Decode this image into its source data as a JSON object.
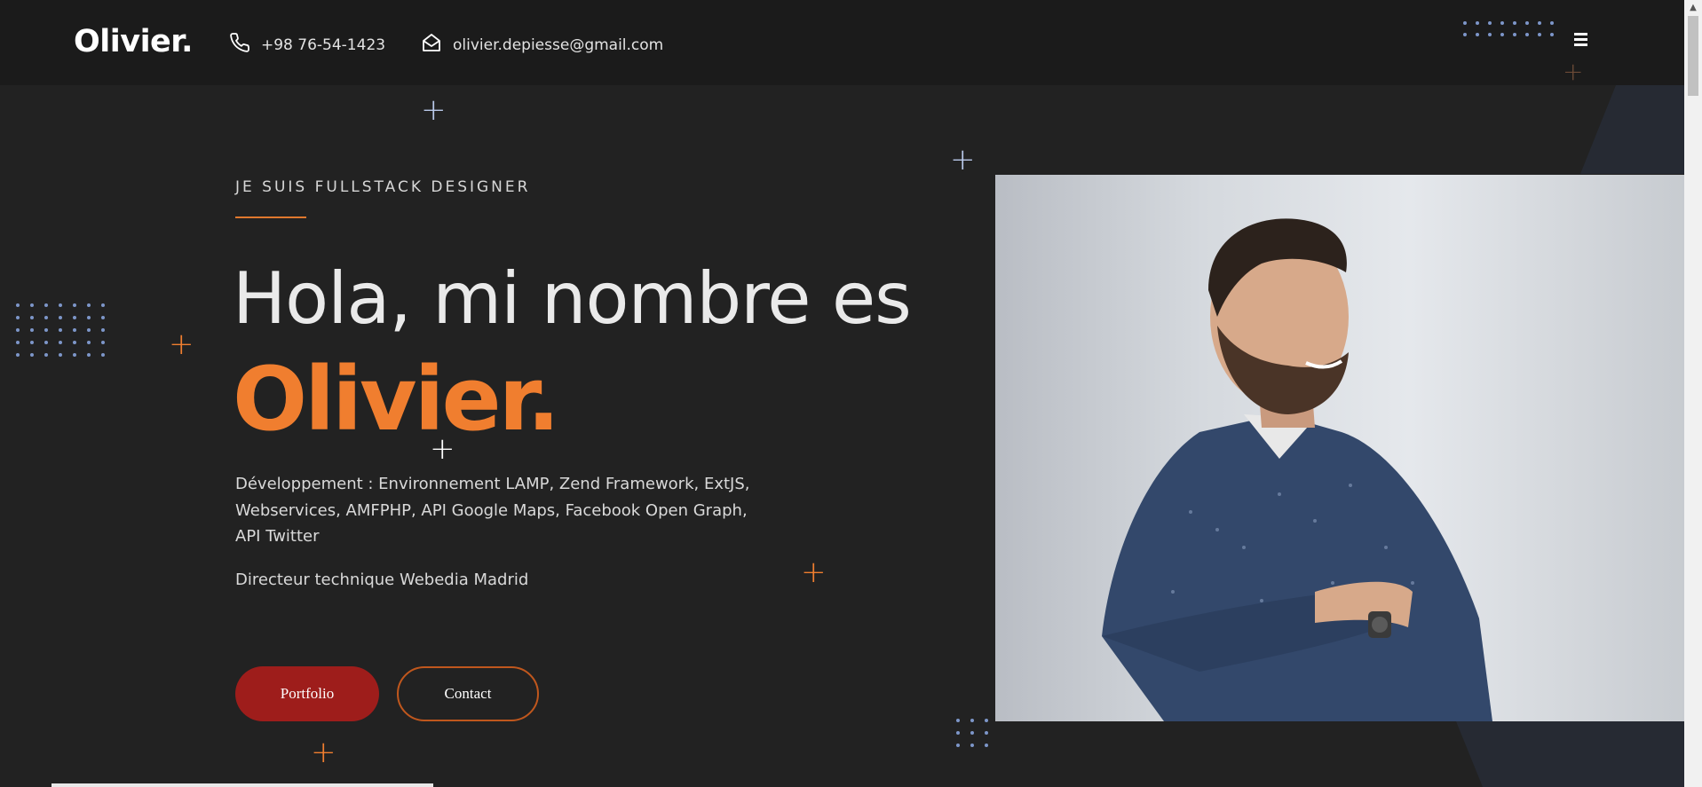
{
  "header": {
    "logo": "Olivier.",
    "phone": "+98 76-54-1423",
    "email": "olivier.depiesse@gmail.com",
    "phone_icon": "phone-icon",
    "email_icon": "envelope-open-icon",
    "menu_icon": "hamburger-menu-icon"
  },
  "hero": {
    "tagline": "JE SUIS FULLSTACK DESIGNER",
    "greeting": "Hola, mi nombre es",
    "name": "Olivier.",
    "description": "Développement : Environnement LAMP, Zend Framework, ExtJS, Webservices, AMFPHP, API Google Maps, Facebook Open Graph, API Twitter",
    "role": "Directeur technique Webedia Madrid",
    "buttons": {
      "portfolio": "Portfolio",
      "contact": "Contact"
    },
    "photo_alt": "portrait-photo"
  },
  "colors": {
    "accent": "#f07e2f",
    "button_red": "#9e1d1b",
    "background": "#222222",
    "header_bg": "#1b1b1b",
    "deco_blue": "#7d96c9"
  }
}
